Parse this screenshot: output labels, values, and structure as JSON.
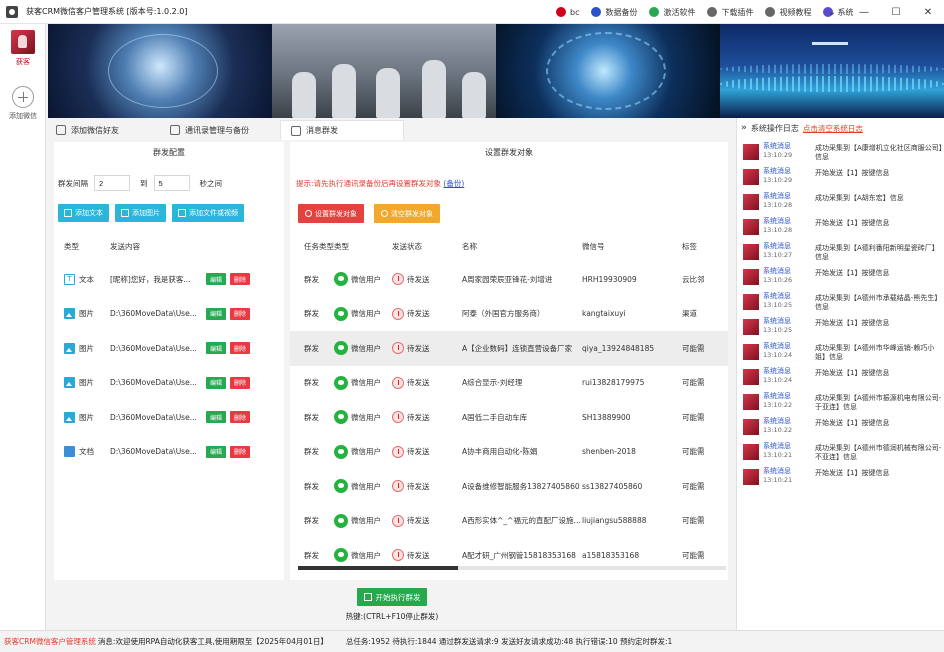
{
  "window": {
    "title": "获客CRM微信客户管理系统 [版本号:1.0.2.0]",
    "actions": [
      {
        "label": "bc",
        "icon": "user-icon",
        "color": "#d0021b"
      },
      {
        "label": "数据备份",
        "icon": "backup-icon",
        "color": "#2a53c9"
      },
      {
        "label": "激活软件",
        "icon": "shield-icon",
        "color": "#27a852"
      },
      {
        "label": "下载插件",
        "icon": "download-icon",
        "color": "#666666"
      },
      {
        "label": "视频教程",
        "icon": "video-icon",
        "color": "#666666"
      },
      {
        "label": "系统",
        "icon": "gear-icon",
        "color": "#5a4bd1"
      }
    ],
    "controls": [
      "⌄",
      "—",
      "☐",
      "✕"
    ]
  },
  "nav": {
    "items": [
      {
        "label": "获客"
      },
      {
        "label": "添加微信"
      }
    ]
  },
  "tabs": [
    {
      "label": "添加微信好友",
      "active": false
    },
    {
      "label": "通讯录管理与备份",
      "active": false
    },
    {
      "label": "消息群发",
      "active": true
    }
  ],
  "left_panel": {
    "title": "群发配置",
    "interval_label": "群发间隔",
    "interval_value": "2",
    "to_label": "到",
    "to_value": "5",
    "unit_label": "秒之间",
    "buttons": [
      "添加文本",
      "添加图片",
      "添加文件或视频"
    ],
    "columns": [
      "类型",
      "发送内容"
    ],
    "rows": [
      {
        "type": "文本",
        "icon": "text",
        "content": "[昵称]您好，我是获客..."
      },
      {
        "type": "图片",
        "icon": "img",
        "content": "D:\\360MoveData\\Use..."
      },
      {
        "type": "图片",
        "icon": "img",
        "content": "D:\\360MoveData\\Use..."
      },
      {
        "type": "图片",
        "icon": "img",
        "content": "D:\\360MoveData\\Use..."
      },
      {
        "type": "图片",
        "icon": "img",
        "content": "D:\\360MoveData\\Use..."
      },
      {
        "type": "文档",
        "icon": "file",
        "content": "D:\\360MoveData\\Use..."
      }
    ],
    "edit_label": "编辑",
    "delete_label": "删除"
  },
  "right_panel": {
    "title": "设置群发对象",
    "notice": "提示:请先执行通讯录备份后再设置群发对象",
    "notice_link": "(备份)",
    "buttons": [
      "设置群发对象",
      "清空群发对象"
    ],
    "columns": [
      "任务类型",
      "类型",
      "发送状态",
      "名称",
      "微信号",
      "标签"
    ],
    "rows": [
      {
        "task": "群发",
        "type": "微信用户",
        "status": "待发送",
        "name": "A周家园荣辰亚锋花-刘增进",
        "wxid": "HRH19930909",
        "tag": "云比邻"
      },
      {
        "task": "群发",
        "type": "微信用户",
        "status": "待发送",
        "name": "阿泰（外国官方服务商）",
        "wxid": "kangtaixuyi",
        "tag": "渠道"
      },
      {
        "task": "群发",
        "type": "微信用户",
        "status": "待发送",
        "name": "A【企业数码】连锁直营设备厂家",
        "wxid": "qiya_13924848185",
        "tag": "可能需"
      },
      {
        "task": "群发",
        "type": "微信用户",
        "status": "待发送",
        "name": "A综合显示-刘经理",
        "wxid": "rui13828179975",
        "tag": "可能需"
      },
      {
        "task": "群发",
        "type": "微信用户",
        "status": "待发送",
        "name": "A国低二手自动车库",
        "wxid": "SH13889900",
        "tag": "可能需"
      },
      {
        "task": "群发",
        "type": "微信用户",
        "status": "待发送",
        "name": "A协丰商用自动化-陈娟",
        "wxid": "shenben-2018",
        "tag": "可能需"
      },
      {
        "task": "群发",
        "type": "微信用户",
        "status": "待发送",
        "name": "A设备维修智能服务13827405860",
        "wxid": "ss13827405860",
        "tag": "可能需"
      },
      {
        "task": "群发",
        "type": "微信用户",
        "status": "待发送",
        "name": "A西形实体^_^福元的直配厂设施设定",
        "wxid": "liujiangsu588888",
        "tag": "可能需"
      },
      {
        "task": "群发",
        "type": "微信用户",
        "status": "待发送",
        "name": "A配才研_广州钢管15818353168",
        "wxid": "a15818353168",
        "tag": "可能需"
      }
    ]
  },
  "send": {
    "button": "开始执行群发",
    "hint": "热键:(CTRL+F10停止群发)"
  },
  "log": {
    "title": "系统操作日志",
    "clear_link": "点击清空系统日志",
    "items": [
      {
        "src": "系统消息",
        "time": "13:10:29",
        "msg": "成功采集到【A康增机立化社区商服公司】信息"
      },
      {
        "src": "系统消息",
        "time": "13:10:29",
        "msg": "开始发送【1】按键信息"
      },
      {
        "src": "系统消息",
        "time": "13:10:28",
        "msg": "成功采集到【A胡东宏】信息"
      },
      {
        "src": "系统消息",
        "time": "13:10:28",
        "msg": "开始发送【1】按键信息"
      },
      {
        "src": "系统消息",
        "time": "13:10:27",
        "msg": "成功采集到【A德利番阳新明星瓷砖厂】信息"
      },
      {
        "src": "系统消息",
        "time": "13:10:26",
        "msg": "开始发送【1】按键信息"
      },
      {
        "src": "系统消息",
        "time": "13:10:25",
        "msg": "成功采集到【A德州市承载结晶-熊先生】信息"
      },
      {
        "src": "系统消息",
        "time": "13:10:25",
        "msg": "开始发送【1】按键信息"
      },
      {
        "src": "系统消息",
        "time": "13:10:24",
        "msg": "成功采集到【A德州市华峰运销-赖巧小姐】信息"
      },
      {
        "src": "系统消息",
        "time": "13:10:24",
        "msg": "开始发送【1】按键信息"
      },
      {
        "src": "系统消息",
        "time": "13:10:22",
        "msg": "成功采集到【A德州市振源机电有限公司-于亚连】信息"
      },
      {
        "src": "系统消息",
        "time": "13:10:22",
        "msg": "开始发送【1】按键信息"
      },
      {
        "src": "系统消息",
        "time": "13:10:21",
        "msg": "成功采集到【A德州市德润机械有限公司-不亚连】信息"
      },
      {
        "src": "系统消息",
        "time": "13:10:21",
        "msg": "开始发送【1】按键信息"
      }
    ]
  },
  "status": {
    "brand": "获客CRM微信客户管理系统",
    "message": "消息:欢迎使用RPA自动化获客工具,使用期限至【2025年04月01日】",
    "stats": "总任务:1952 待执行:1844 通过群发送请求:9 发送好友请求成功:48 执行错误:10 预约定时群发:1"
  },
  "colors": {
    "accent_cyan": "#2ab6d9",
    "edit_green": "#27a852",
    "delete_red": "#e83a43",
    "warn_red": "#e33b2e",
    "link_blue": "#2a53c9",
    "orange": "#f3a72c"
  }
}
